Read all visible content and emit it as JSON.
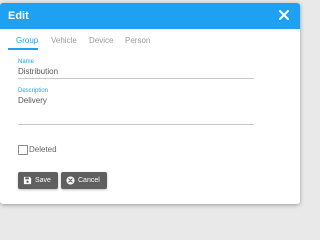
{
  "dialog": {
    "title": "Edit",
    "close_icon": "close-icon"
  },
  "tabs": [
    {
      "label": "Group",
      "active": true
    },
    {
      "label": "Vehicle",
      "active": false
    },
    {
      "label": "Device",
      "active": false
    },
    {
      "label": "Person",
      "active": false
    }
  ],
  "form": {
    "name_label": "Name",
    "name_value": "Distribution",
    "description_label": "Description",
    "description_value": "Delivery",
    "deleted_label": "Deleted",
    "deleted_checked": false
  },
  "buttons": {
    "save_label": "Save",
    "cancel_label": "Cancel",
    "save_icon": "floppy-disk-icon",
    "cancel_icon": "x-circle-icon"
  },
  "colors": {
    "accent": "#1ea1f2",
    "button": "#5f5f5f"
  }
}
